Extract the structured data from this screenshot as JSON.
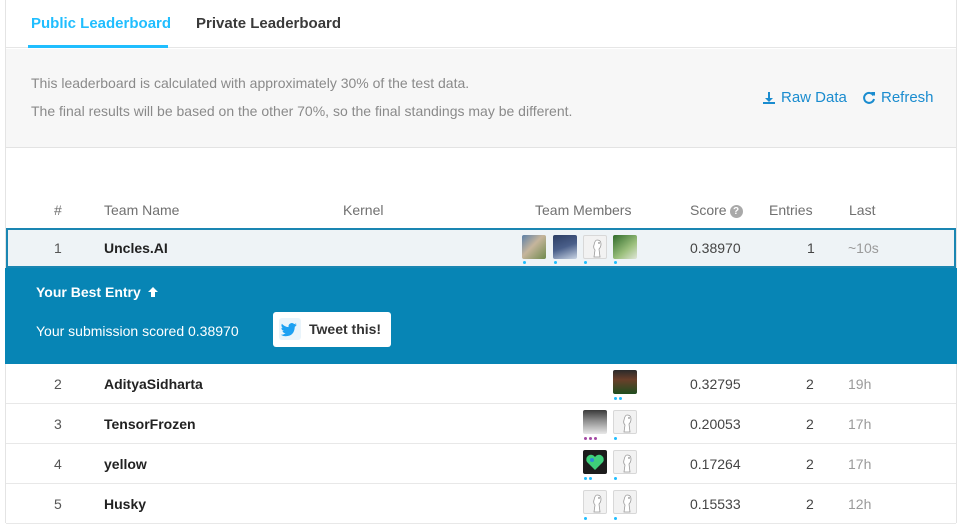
{
  "tabs": [
    {
      "label": "Public Leaderboard",
      "active": true
    },
    {
      "label": "Private Leaderboard",
      "active": false
    }
  ],
  "info": {
    "line1": "This leaderboard is calculated with approximately 30% of the test data.",
    "line2": "The final results will be based on the other 70%, so the final standings may be different.",
    "raw_data": "Raw Data",
    "refresh": "Refresh"
  },
  "columns": {
    "rank": "#",
    "team": "Team Name",
    "kernel": "Kernel",
    "members": "Team Members",
    "score": "Score",
    "entries": "Entries",
    "last": "Last"
  },
  "rows": [
    {
      "rank": "1",
      "team": "Uncles.AI",
      "score": "0.38970",
      "entries": "1",
      "last": "~10s"
    },
    {
      "rank": "2",
      "team": "AdityaSidharta",
      "score": "0.32795",
      "entries": "2",
      "last": "19h"
    },
    {
      "rank": "3",
      "team": "TensorFrozen",
      "score": "0.20053",
      "entries": "2",
      "last": "17h"
    },
    {
      "rank": "4",
      "team": "yellow",
      "score": "0.17264",
      "entries": "2",
      "last": "17h"
    },
    {
      "rank": "5",
      "team": "Husky",
      "score": "0.15533",
      "entries": "2",
      "last": "12h"
    }
  ],
  "best_entry": {
    "title": "Your Best Entry",
    "text": "Your submission scored 0.38970",
    "tweet_label": "Tweet this!"
  },
  "colors": {
    "accent": "#20beff",
    "link": "#1a8ccf",
    "banner": "#0785b5",
    "highlight_border": "#1a86b2"
  },
  "icons": [
    "download-icon",
    "refresh-icon",
    "help-icon",
    "arrow-up-icon",
    "twitter-icon"
  ]
}
